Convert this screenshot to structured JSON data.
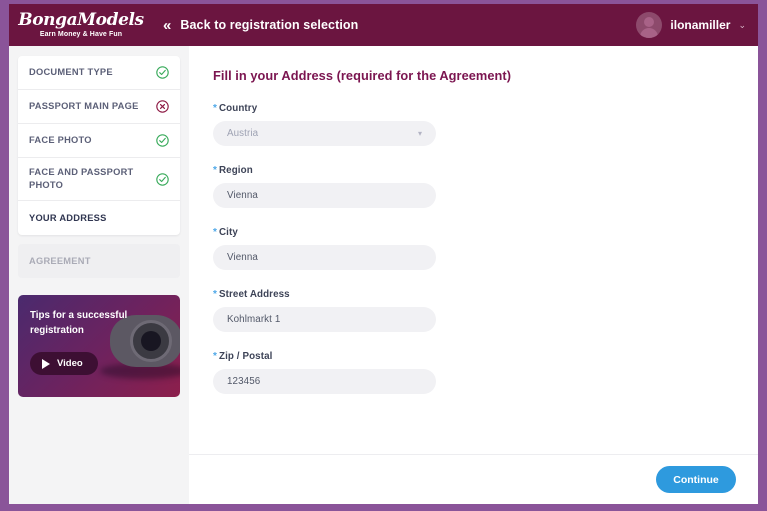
{
  "header": {
    "logo_word": "BongaModels",
    "logo_tagline": "Earn Money & Have Fun",
    "back_chevrons": "«",
    "back_label": "Back to registration selection",
    "user_name": "ilonamiller",
    "user_caret": "⌄"
  },
  "sidebar": {
    "steps": [
      {
        "label": "DOCUMENT TYPE",
        "status": "complete"
      },
      {
        "label": "PASSPORT MAIN PAGE",
        "status": "error"
      },
      {
        "label": "FACE PHOTO",
        "status": "complete"
      },
      {
        "label": "FACE AND PASSPORT PHOTO",
        "status": "complete"
      },
      {
        "label": "YOUR ADDRESS",
        "status": "active"
      }
    ],
    "disabled_step": {
      "label": "AGREEMENT",
      "status": "disabled"
    },
    "promo": {
      "title": "Tips for a successful registration",
      "button_label": "Video"
    }
  },
  "main": {
    "title": "Fill in your Address (required for the Agreement)",
    "fields": [
      {
        "label": "Country",
        "value": "Austria",
        "required": true,
        "type": "select"
      },
      {
        "label": "Region",
        "value": "Vienna",
        "required": true,
        "type": "text"
      },
      {
        "label": "City",
        "value": "Vienna",
        "required": true,
        "type": "text"
      },
      {
        "label": "Street Address",
        "value": "Kohlmarkt 1",
        "required": true,
        "type": "text"
      },
      {
        "label": "Zip / Postal",
        "value": "123456",
        "required": true,
        "type": "text"
      }
    ],
    "continue_label": "Continue"
  },
  "colors": {
    "header_bg": "#6b1540",
    "frame_border": "#8a5499",
    "title": "#7b1550",
    "accent_button": "#2e9ade",
    "status_complete": "#3aab5c",
    "status_error": "#8e1b45",
    "required_star": "#4fa8e8"
  }
}
